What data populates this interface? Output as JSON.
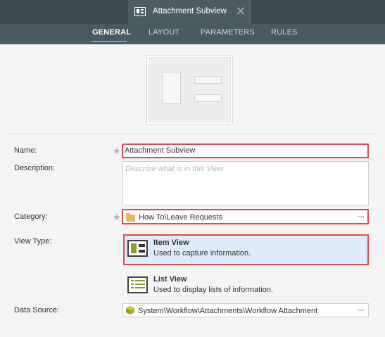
{
  "tab": {
    "title": "Attachment Subview",
    "close_glyph": "✕"
  },
  "nav": {
    "items": [
      {
        "label": "GENERAL"
      },
      {
        "label": "LAYOUT"
      },
      {
        "label": "PARAMETERS"
      },
      {
        "label": "RULES"
      }
    ]
  },
  "form": {
    "name_label": "Name:",
    "name_value": "Attachment Subview",
    "description_label": "Description:",
    "description_placeholder": "Describe what is in this View",
    "category_label": "Category:",
    "category_value": "How To\\Leave Requests",
    "view_type_label": "View Type:",
    "data_source_label": "Data Source:",
    "data_source_value": "System\\Workflow\\Attachments\\Workflow Attachment",
    "required_marker": "★",
    "ellipsis": "···"
  },
  "view_types": [
    {
      "title": "Item View",
      "description": "Used to capture information.",
      "selected": true
    },
    {
      "title": "List View",
      "description": "Used to display lists of information.",
      "selected": false
    }
  ],
  "colors": {
    "highlight": "#e24a4f",
    "accent": "#4fa9dd",
    "selected_bg": "#ddecf8"
  }
}
